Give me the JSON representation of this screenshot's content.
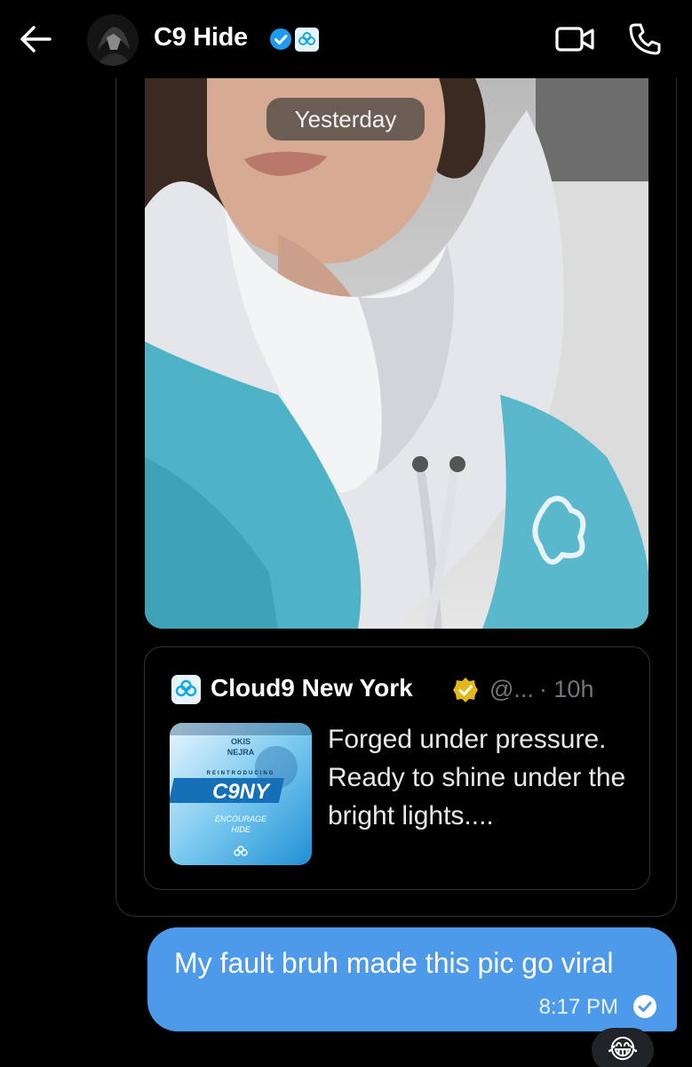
{
  "header": {
    "title": "C9 Hide",
    "icons": {
      "back": "back-arrow-icon",
      "verified": "verified-badge-icon",
      "affiliate": "cloud9-affiliate-icon",
      "video": "video-call-icon",
      "call": "phone-icon"
    }
  },
  "conversation": {
    "date_divider": "Yesterday",
    "quoted_post": {
      "author": "Cloud9 New York",
      "handle": "@...",
      "time": "· 10h",
      "text": "Forged under pressure. Ready to shine under the bright lights....",
      "thumbnail": {
        "top_names": [
          "OKIS",
          "NEJRA"
        ],
        "eyebrow": "REINTRODUCING",
        "logo": "C9NY",
        "bottom_names": [
          "ENCOURAGE",
          "HIDE"
        ]
      }
    },
    "sent_message": {
      "text": "My fault bruh made this pic go viral",
      "time": "8:17 PM"
    },
    "reaction": "😂"
  },
  "colors": {
    "background": "#000000",
    "sent_bubble": "#4c9ae9",
    "verified_blue": "#1d9bf0",
    "gold_badge": "#e2b719",
    "border": "#2f3336",
    "muted_text": "#71767b"
  }
}
